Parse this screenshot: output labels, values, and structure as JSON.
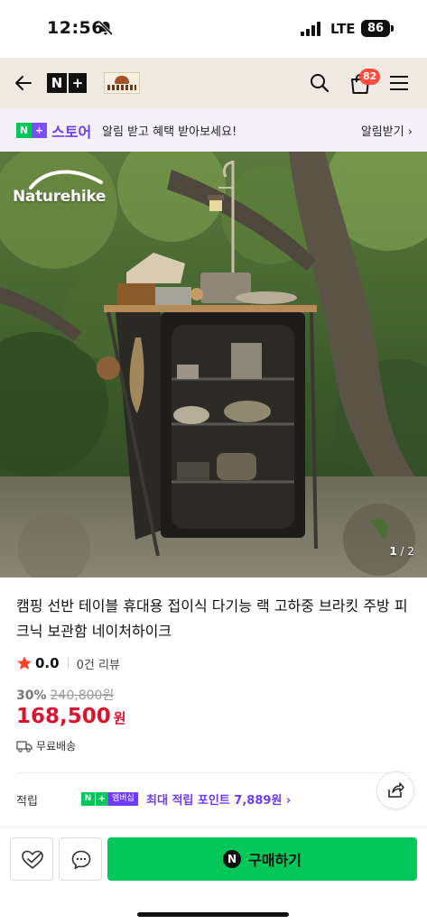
{
  "status_bar": {
    "time": "12:56",
    "network": "LTE",
    "battery": "86",
    "icons": [
      "mute-icon",
      "signal-icon"
    ]
  },
  "header": {
    "logo_text_n": "N",
    "logo_text_plus": "+",
    "cart_count": "82",
    "icons": [
      "back-icon",
      "search-icon",
      "cart-icon",
      "menu-icon"
    ]
  },
  "store_bar": {
    "badge_n": "N",
    "badge_plus": "+",
    "store_label": "스토어",
    "message": "알림 받고 혜택 받아보세요!",
    "notify_link": "알림받기 ›"
  },
  "product_image": {
    "watermark": "Naturehike",
    "current_index": "1",
    "separator": " / ",
    "total": "2"
  },
  "product": {
    "title": "캠핑 선반 테이블 휴대용 접이식 다기능 랙 고하중 브라킷 주방 피크닉 보관함 네이처하이크",
    "rating": "0.0",
    "review_count": "0건 리뷰",
    "discount_rate": "30%",
    "original_price": "240,800원",
    "sale_price": "168,500",
    "sale_unit": "원",
    "shipping": "무료배송"
  },
  "points": {
    "label": "적립",
    "badge_n": "N",
    "badge_plus": "+",
    "badge_membership": "멤버십",
    "text": "최대 적립 포인트 7,889원 ›"
  },
  "bottom_bar": {
    "buy_icon": "N",
    "buy_label": "구매하기",
    "icons": [
      "heart-check-icon",
      "chat-icon"
    ]
  },
  "colors": {
    "naver_green": "#03c75a",
    "accent_purple": "#6e3cf6",
    "price_red": "#d8142f",
    "badge_red": "#ff4b3e",
    "header_bg": "#efe9e2"
  }
}
